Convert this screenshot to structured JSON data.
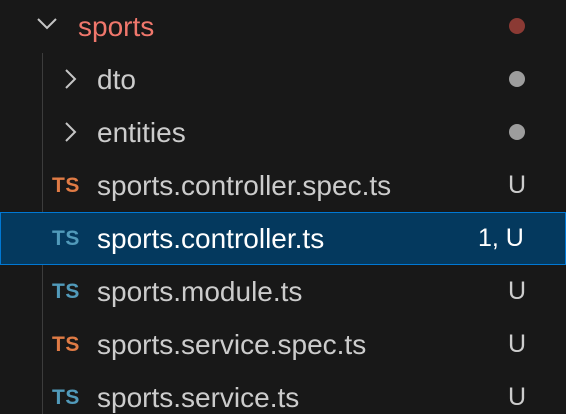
{
  "explorer": {
    "folder": {
      "name": "sports",
      "expanded": true,
      "dot_color": "#8b3a34",
      "chevron_icon": "chevron-down-icon"
    },
    "subfolders": [
      {
        "name": "dto",
        "expanded": false,
        "chevron_icon": "chevron-right-icon",
        "dot_color": "#9d9d9d"
      },
      {
        "name": "entities",
        "expanded": false,
        "chevron_icon": "chevron-right-icon",
        "dot_color": "#9d9d9d"
      }
    ],
    "files": [
      {
        "icon": "TS",
        "icon_color": "#e07b45",
        "name": "sports.controller.spec.ts",
        "status": "U",
        "selected": false
      },
      {
        "icon": "TS",
        "icon_color": "#519aba",
        "name": "sports.controller.ts",
        "status": "1, U",
        "selected": true
      },
      {
        "icon": "TS",
        "icon_color": "#519aba",
        "name": "sports.module.ts",
        "status": "U",
        "selected": false
      },
      {
        "icon": "TS",
        "icon_color": "#e07b45",
        "name": "sports.service.spec.ts",
        "status": "U",
        "selected": false
      },
      {
        "icon": "TS",
        "icon_color": "#519aba",
        "name": "sports.service.ts",
        "status": "U",
        "selected": false
      }
    ],
    "colors": {
      "background": "#181818",
      "selection_background": "#04395e",
      "selection_border": "#0078d4",
      "folder_label": "#f0776c",
      "text": "#cccccc"
    }
  }
}
